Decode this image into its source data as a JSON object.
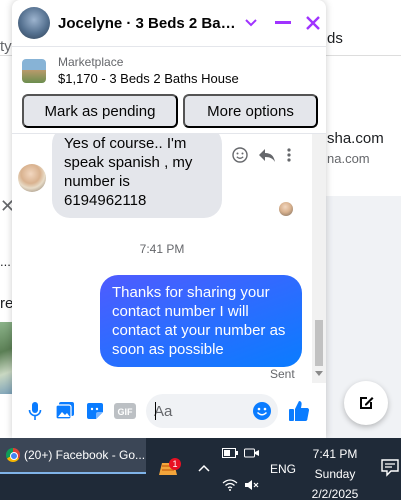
{
  "background": {
    "topbar_fragment": "ty",
    "right_fragment_top": "ds",
    "right_fragment_email": "sha.com",
    "right_fragment_email2": "na.com",
    "left_dots": "...",
    "left_fragment": "re",
    "left_close": "✕"
  },
  "chat": {
    "title": "Jocelyne · 3 Beds 2 Baths ...",
    "marketplace_label": "Marketplace",
    "listing_title": "$1,170 - 3 Beds 2 Baths House",
    "mark_pending_label": "Mark as pending",
    "more_options_label": "More options",
    "incoming_message": "Yes of course.. I'm speak spanish , my number is 6194962118",
    "timestamp": "7:41 PM",
    "outgoing_message": "Thanks for sharing your contact number I will contact at your number as soon as possible",
    "status": "Sent",
    "input_placeholder": "Aa",
    "icons": {
      "chevron": "chevron-down-icon",
      "minimize": "minimize-icon",
      "close": "close-icon",
      "mic": "microphone-icon",
      "image": "image-icon",
      "sticker": "sticker-icon",
      "gif": "gif-icon",
      "emoji": "emoji-icon",
      "like": "thumbs-up-icon"
    },
    "colors": {
      "accent": "#a033ff",
      "blue": "#0a7cff"
    }
  },
  "taskbar": {
    "app_label": "(20+) Facebook - Go...",
    "notification_badge": "1",
    "language": "ENG",
    "time": "7:41 PM",
    "day": "Sunday",
    "date": "2/2/2025"
  }
}
